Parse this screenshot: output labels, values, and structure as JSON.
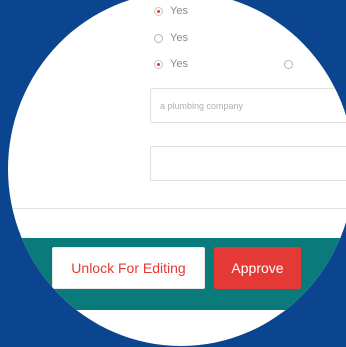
{
  "radio_group": {
    "options": [
      {
        "label": "Yes",
        "checked": true
      },
      {
        "label": "Yes",
        "checked": false
      },
      {
        "label": "Yes",
        "checked": true
      }
    ]
  },
  "inputs": {
    "company_placeholder": "a plumbing company",
    "second_value": ""
  },
  "footer": {
    "unlock_label": "Unlock For Editing",
    "approve_label": "Approve"
  },
  "colors": {
    "background": "#0b4590",
    "footer_bg": "#0a7a7a",
    "accent": "#e53935"
  }
}
